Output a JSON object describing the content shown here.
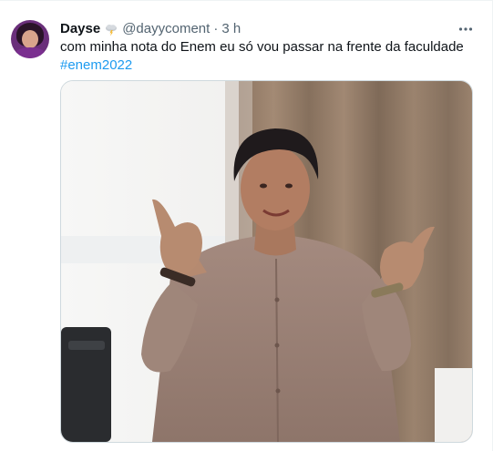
{
  "tweet": {
    "author_name": "Dayse",
    "author_handle": "@dayycoment",
    "separator": "·",
    "time": "3 h",
    "text": "com minha nota do Enem eu só vou passar na frente da faculdade",
    "hashtag": "#enem2022",
    "badge_icon": "storm-cloud-icon",
    "more_icon": "more-horizontal-icon"
  },
  "colors": {
    "text_primary": "#0f1419",
    "text_secondary": "#536471",
    "link": "#1d9bf0",
    "border": "#cfd9de"
  }
}
